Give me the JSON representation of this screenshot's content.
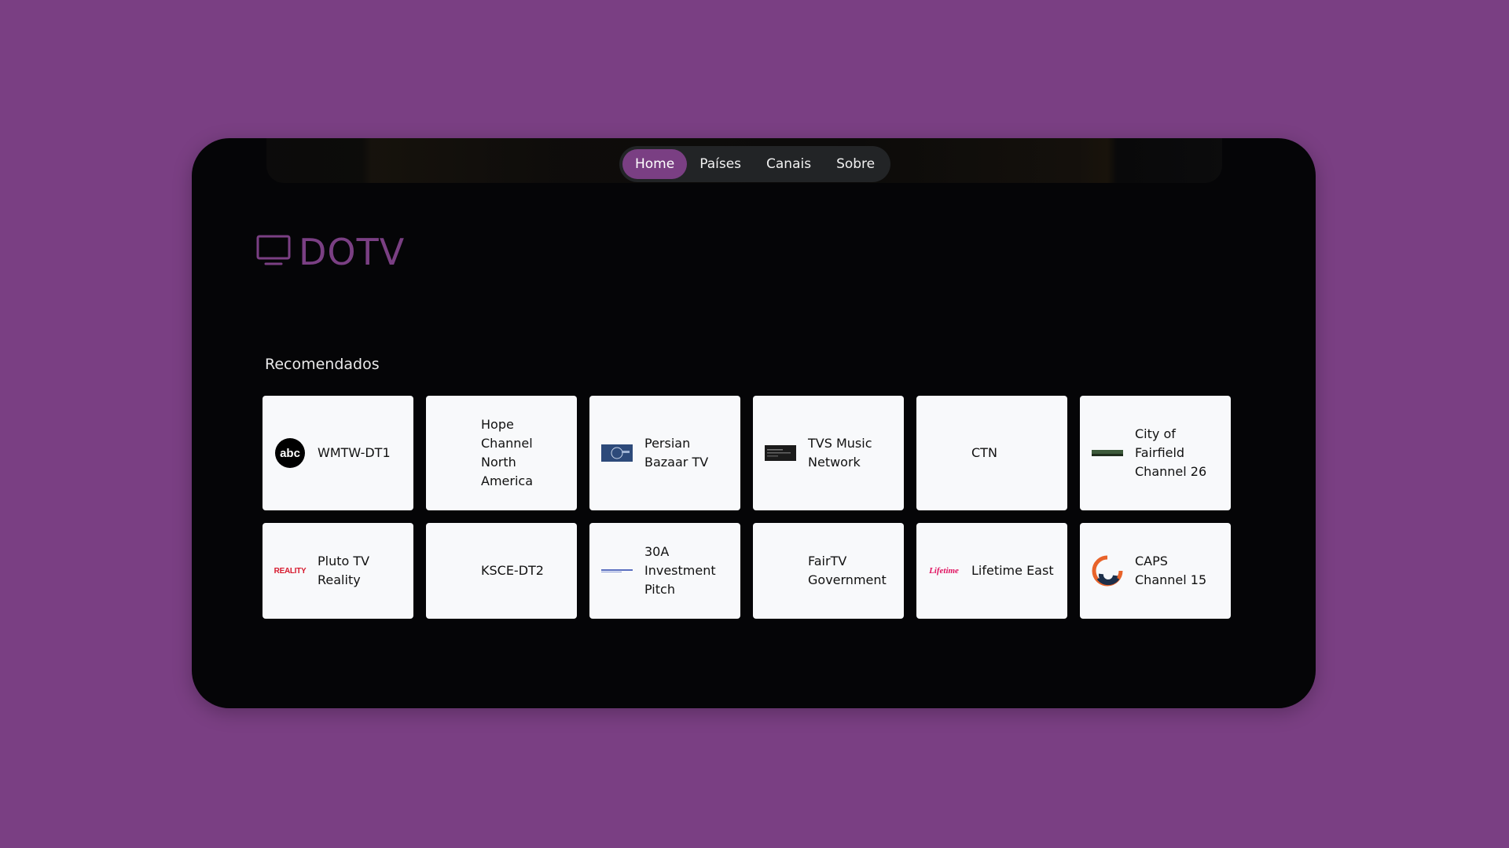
{
  "nav": {
    "items": [
      {
        "label": "Home",
        "active": true
      },
      {
        "label": "Países",
        "active": false
      },
      {
        "label": "Canais",
        "active": false
      },
      {
        "label": "Sobre",
        "active": false
      }
    ]
  },
  "brand": {
    "name": "DOTV",
    "color": "#7a3f83",
    "icon": "tv-icon"
  },
  "recommended": {
    "title": "Recomendados",
    "channels": [
      {
        "name": "WMTW-DT1",
        "logo": "abc-logo"
      },
      {
        "name": "Hope Channel North America",
        "logo": ""
      },
      {
        "name": "Persian Bazaar TV",
        "logo": "persian-bazaar-logo"
      },
      {
        "name": "TVS Music Network",
        "logo": "tvs-logo"
      },
      {
        "name": "CTN",
        "logo": ""
      },
      {
        "name": "City of Fairfield Channel 26",
        "logo": "fairfield-logo"
      },
      {
        "name": "Pluto TV Reality",
        "logo": "reality-logo",
        "logo_text": "REALITY"
      },
      {
        "name": "KSCE-DT2",
        "logo": ""
      },
      {
        "name": "30A Investment Pitch",
        "logo": "investment-pitch-logo"
      },
      {
        "name": "FairTV Government",
        "logo": ""
      },
      {
        "name": "Lifetime East",
        "logo": "lifetime-logo",
        "logo_text": "Lifetime"
      },
      {
        "name": "CAPS Channel 15",
        "logo": "caps-logo"
      }
    ]
  },
  "colors": {
    "background": "#7a3f83",
    "window": "#050507",
    "card": "#f8f9fb",
    "nav_active": "#7a3f83"
  }
}
